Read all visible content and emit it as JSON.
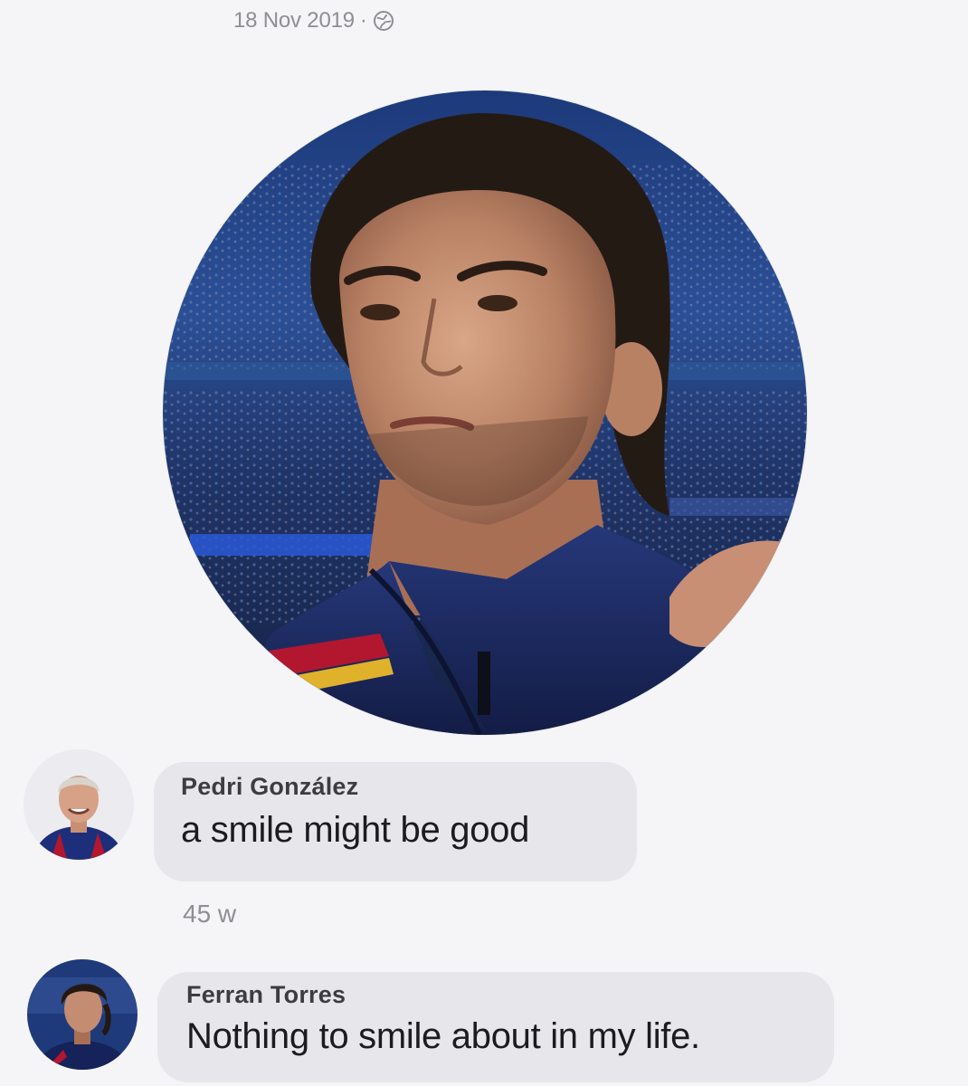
{
  "post": {
    "date": "18 Nov 2019",
    "separator": "·",
    "privacy_icon": "globe-icon"
  },
  "comments": [
    {
      "author": "Pedri González",
      "text": "a smile might be good",
      "time": "45 w",
      "avatar_icon": "avatar-photo"
    },
    {
      "author": "Ferran Torres",
      "text": "Nothing to smile about in my life.",
      "avatar_icon": "avatar-photo"
    }
  ],
  "colors": {
    "background": "#f5f5f7",
    "bubble": "#e7e7eb",
    "meta_text": "#8e8e93",
    "jacket_navy": "#1c2a66",
    "stripe_red": "#b3172f"
  }
}
